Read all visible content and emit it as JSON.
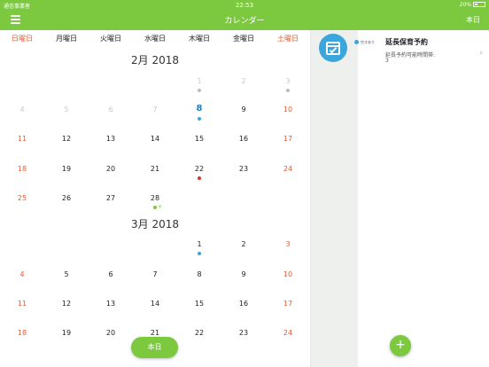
{
  "status_bar": {
    "carrier": "通信事業者",
    "time": "22:53",
    "battery": "20%"
  },
  "navbar": {
    "title": "カレンダー",
    "today_label": "本日"
  },
  "weekdays": [
    "日曜日",
    "月曜日",
    "火曜日",
    "水曜日",
    "木曜日",
    "金曜日",
    "土曜日"
  ],
  "months": [
    {
      "title": "2月 2018",
      "weeks": [
        [
          "",
          "",
          "",
          "",
          "1",
          "2",
          "3"
        ],
        [
          "4",
          "5",
          "6",
          "7",
          "8",
          "9",
          "10"
        ],
        [
          "11",
          "12",
          "13",
          "14",
          "15",
          "16",
          "17"
        ],
        [
          "18",
          "19",
          "20",
          "21",
          "22",
          "23",
          "24"
        ],
        [
          "25",
          "26",
          "27",
          "28",
          "",
          "",
          ""
        ]
      ]
    },
    {
      "title": "3月 2018",
      "weeks": [
        [
          "",
          "",
          "",
          "",
          "1",
          "2",
          "3"
        ],
        [
          "4",
          "5",
          "6",
          "7",
          "8",
          "9",
          "10"
        ],
        [
          "11",
          "12",
          "13",
          "14",
          "15",
          "16",
          "17"
        ],
        [
          "18",
          "19",
          "20",
          "21",
          "22",
          "23",
          "24"
        ]
      ]
    }
  ],
  "today_pill": "本日",
  "event": {
    "badge": "空きあり",
    "title": "延長保育予約",
    "subtitle": "延長予約可能時間帯:",
    "value": "3"
  },
  "fab_symbol": "+",
  "colors": {
    "accent": "#7cc93f",
    "weekend": "#e25c3a",
    "today": "#1f7fc4",
    "event_blue": "#3aa6dc",
    "event_red": "#d8302e"
  }
}
